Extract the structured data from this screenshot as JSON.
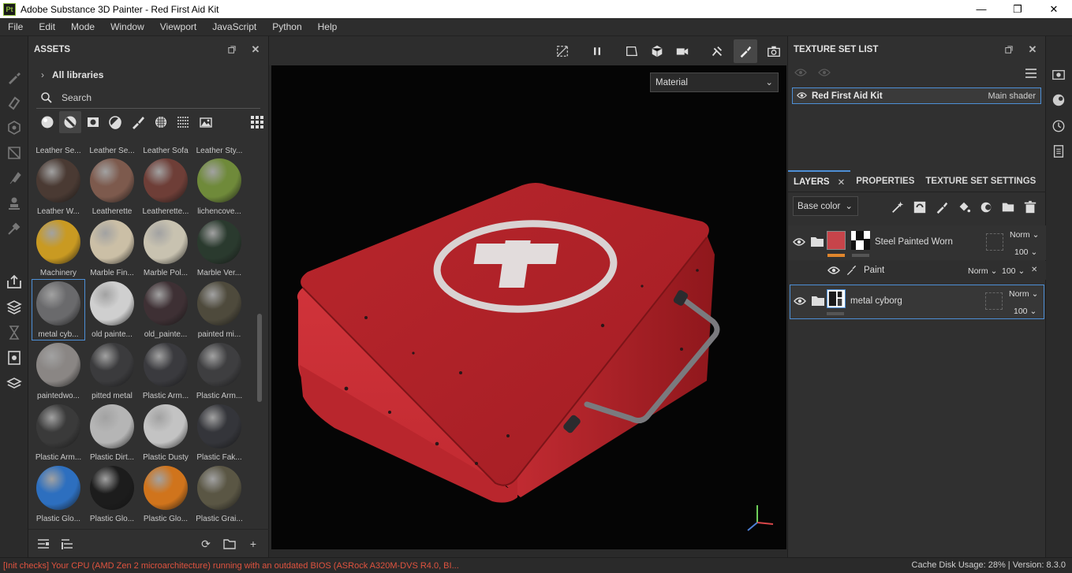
{
  "window": {
    "app_icon_text": "Pt",
    "title": "Adobe Substance 3D Painter - Red First Aid Kit",
    "minimize": "—",
    "maximize": "❐",
    "close": "✕"
  },
  "menu": [
    "File",
    "Edit",
    "Mode",
    "Window",
    "Viewport",
    "JavaScript",
    "Python",
    "Help"
  ],
  "assets": {
    "title": "ASSETS",
    "library": "All libraries",
    "search_placeholder": "Search",
    "rows": [
      {
        "partial": true,
        "items": [
          {
            "label": "Leather Se...",
            "color": "#5a4236"
          },
          {
            "label": "Leather Se...",
            "color": "#6a4a3a"
          },
          {
            "label": "Leather Sofa",
            "color": "#4a3228"
          },
          {
            "label": "Leather Sty...",
            "color": "#3c3c3c"
          }
        ]
      },
      {
        "items": [
          {
            "label": "Leather W...",
            "color": "#4a3a33"
          },
          {
            "label": "Leatherette",
            "color": "#7d5a4d"
          },
          {
            "label": "Leatherette...",
            "color": "#6e3e37"
          },
          {
            "label": "lichencove...",
            "color": "#6f8a3a"
          }
        ]
      },
      {
        "items": [
          {
            "label": "Machinery",
            "color": "#c99a22"
          },
          {
            "label": "Marble Fin...",
            "color": "#cbbfa6"
          },
          {
            "label": "Marble Pol...",
            "color": "#c8c2b0"
          },
          {
            "label": "Marble Ver...",
            "color": "#2a3a2e"
          }
        ]
      },
      {
        "items": [
          {
            "label": "metal cyb...",
            "color": "#6a6a6c",
            "selected": true
          },
          {
            "label": "old painte...",
            "color": "#cfcfcf"
          },
          {
            "label": "old_painte...",
            "color": "#3e3034"
          },
          {
            "label": "painted mi...",
            "color": "#4e4a3c"
          }
        ]
      },
      {
        "items": [
          {
            "label": "paintedwo...",
            "color": "#8a8684"
          },
          {
            "label": "pitted metal",
            "color": "#3b3b3d"
          },
          {
            "label": "Plastic Arm...",
            "color": "#3a3a3e"
          },
          {
            "label": "Plastic Arm...",
            "color": "#3e3e40"
          }
        ]
      },
      {
        "items": [
          {
            "label": "Plastic Arm...",
            "color": "#3a3a3a"
          },
          {
            "label": "Plastic Dirt...",
            "color": "#b5b5b5"
          },
          {
            "label": "Plastic Dusty",
            "color": "#c3c3c3"
          },
          {
            "label": "Plastic Fak...",
            "color": "#34353a"
          }
        ]
      },
      {
        "items": [
          {
            "label": "Plastic Glo...",
            "color": "#2d6fbf"
          },
          {
            "label": "Plastic Glo...",
            "color": "#1c1c1c"
          },
          {
            "label": "Plastic Glo...",
            "color": "#d0741c"
          },
          {
            "label": "Plastic Grai...",
            "color": "#5a5644"
          }
        ]
      }
    ]
  },
  "viewport": {
    "display_mode": "Material"
  },
  "texture_set_list": {
    "title": "TEXTURE SET LIST",
    "item_name": "Red First Aid Kit",
    "item_shader": "Main shader"
  },
  "tabs": {
    "layers": "LAYERS",
    "properties": "PROPERTIES",
    "texture_set_settings": "TEXTURE SET SETTINGS"
  },
  "layers": {
    "channel": "Base color",
    "items": [
      {
        "name": "Steel Painted Worn",
        "blend": "Norm",
        "opacity": "100"
      },
      {
        "name": "Paint",
        "blend": "Norm",
        "opacity": "100"
      },
      {
        "name": "metal cyborg",
        "blend": "Norm",
        "opacity": "100"
      }
    ]
  },
  "status": {
    "message": "[Init checks] Your CPU (AMD Zen 2 microarchitecture) running with an outdated BIOS (ASRock A320M-DVS R4.0, BI...",
    "right": "Cache Disk Usage:    28% | Version: 8.3.0"
  },
  "colors": {
    "accent": "#4d8fd6",
    "kit_red": "#c0272d",
    "status_error": "#e0533f"
  }
}
